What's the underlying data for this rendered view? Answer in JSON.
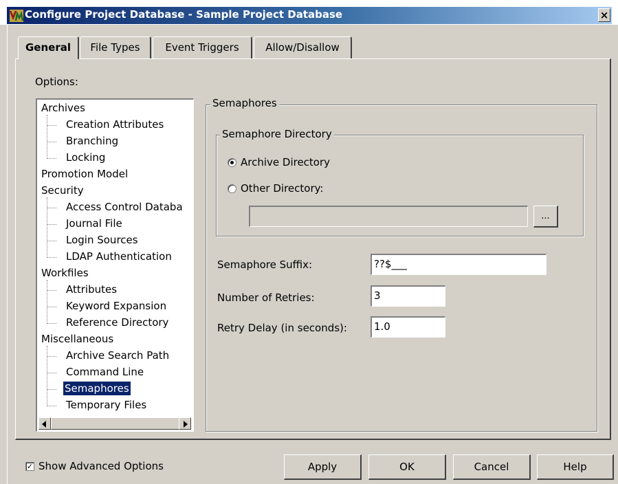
{
  "window": {
    "title": "Configure Project Database - Sample Project Database",
    "close_glyph": "×"
  },
  "tabs": [
    {
      "label": "General",
      "active": true
    },
    {
      "label": "File Types",
      "active": false
    },
    {
      "label": "Event Triggers",
      "active": false
    },
    {
      "label": "Allow/Disallow",
      "active": false
    }
  ],
  "options_label": "Options:",
  "tree": {
    "archives": "Archives",
    "creation_attributes": "Creation Attributes",
    "branching": "Branching",
    "locking": "Locking",
    "promotion_model": "Promotion Model",
    "security": "Security",
    "access_control": "Access Control Databa",
    "journal_file": "Journal File",
    "login_sources": "Login Sources",
    "ldap": "LDAP Authentication",
    "workfiles": "Workfiles",
    "attributes": "Attributes",
    "keyword_expansion": "Keyword Expansion",
    "reference_directory": "Reference Directory",
    "miscellaneous": "Miscellaneous",
    "archive_search_path": "Archive Search Path",
    "command_line": "Command Line",
    "semaphores": "Semaphores",
    "temporary_files": "Temporary Files",
    "selected": "Semaphores"
  },
  "semaphores": {
    "group_title": "Semaphores",
    "dir_group_title": "Semaphore Directory",
    "archive_directory_label": "Archive Directory",
    "other_directory_label": "Other Directory:",
    "selected_option": "Archive Directory",
    "other_directory_value": "",
    "browse_label": "...",
    "suffix_label": "Semaphore Suffix:",
    "suffix_value": "??$___",
    "retries_label": "Number of Retries:",
    "retries_value": "3",
    "delay_label": "Retry Delay (in seconds):",
    "delay_value": "1.0"
  },
  "footer": {
    "show_advanced_label": "Show Advanced Options",
    "show_advanced_checked": true,
    "check_glyph": "✓",
    "apply_label": "Apply",
    "ok_label": "OK",
    "cancel_label": "Cancel",
    "help_label": "Help"
  }
}
